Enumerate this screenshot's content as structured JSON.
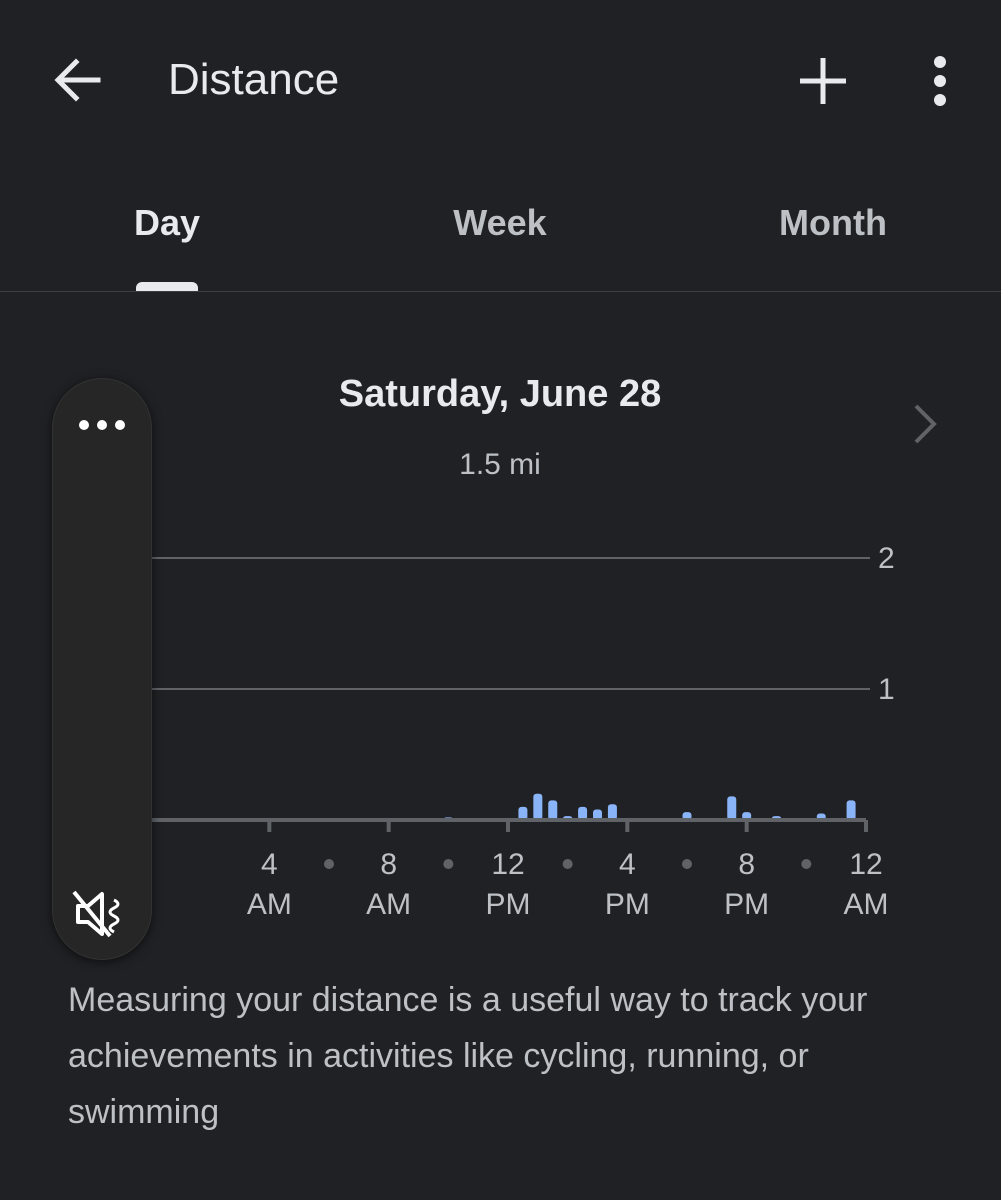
{
  "app_bar": {
    "title": "Distance",
    "back_icon": "arrow-back-icon",
    "add_icon": "add-icon",
    "more_icon": "more-vert-icon"
  },
  "tabs": [
    {
      "label": "Day",
      "selected": true
    },
    {
      "label": "Week",
      "selected": false
    },
    {
      "label": "Month",
      "selected": false
    }
  ],
  "date_header": {
    "title": "Saturday, June 28",
    "subtitle": "1.5 mi",
    "next_icon": "chevron-right-icon"
  },
  "volume_panel": {
    "dots_icon": "more-horiz-icon",
    "mute_icon": "volume-off-icon"
  },
  "chart_data": {
    "type": "bar",
    "xlabel": "",
    "ylabel": "",
    "ylim": [
      0,
      2
    ],
    "yticks": [
      "1",
      "2"
    ],
    "x_labels": [
      {
        "top": "4",
        "bottom": "AM"
      },
      {
        "top": "8",
        "bottom": "AM"
      },
      {
        "top": "12",
        "bottom": "PM"
      },
      {
        "top": "4",
        "bottom": "PM"
      },
      {
        "top": "8",
        "bottom": "PM"
      },
      {
        "top": "12",
        "bottom": "AM"
      }
    ],
    "bar_color": "#8ab4f8",
    "bars": [
      {
        "hour": 10.0,
        "value": 0.02
      },
      {
        "hour": 12.5,
        "value": 0.1
      },
      {
        "hour": 13.0,
        "value": 0.2
      },
      {
        "hour": 13.5,
        "value": 0.15
      },
      {
        "hour": 14.0,
        "value": 0.03
      },
      {
        "hour": 14.5,
        "value": 0.1
      },
      {
        "hour": 15.0,
        "value": 0.08
      },
      {
        "hour": 15.5,
        "value": 0.12
      },
      {
        "hour": 18.0,
        "value": 0.06
      },
      {
        "hour": 19.5,
        "value": 0.18
      },
      {
        "hour": 20.0,
        "value": 0.06
      },
      {
        "hour": 21.0,
        "value": 0.03
      },
      {
        "hour": 22.5,
        "value": 0.05
      },
      {
        "hour": 23.5,
        "value": 0.15
      }
    ]
  },
  "description": "Measuring your distance is a useful way to track your achievements in activities like cycling, running, or swimming"
}
